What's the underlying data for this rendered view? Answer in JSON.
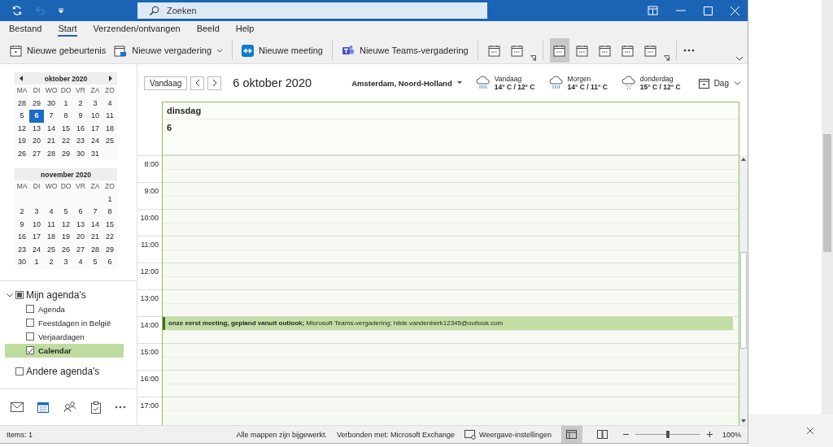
{
  "window": {
    "search_placeholder": "Zoeken"
  },
  "menu_tabs": [
    {
      "label": "Bestand",
      "selected": false
    },
    {
      "label": "Start",
      "selected": true
    },
    {
      "label": "Verzenden/ontvangen",
      "selected": false
    },
    {
      "label": "Beeld",
      "selected": false
    },
    {
      "label": "Help",
      "selected": false
    }
  ],
  "ribbon": [
    {
      "kind": "event",
      "label": "Nieuwe gebeurtenis"
    },
    {
      "kind": "meeting-request",
      "label": "Nieuwe vergadering",
      "dropdown": true
    },
    {
      "kind": "separator"
    },
    {
      "kind": "teams-app",
      "label": "Nieuwe meeting"
    },
    {
      "kind": "separator"
    },
    {
      "kind": "teams",
      "label": "Nieuwe Teams-vergadering"
    },
    {
      "kind": "separator"
    },
    {
      "kind": "view",
      "selected": false
    },
    {
      "kind": "view",
      "selected": false
    },
    {
      "kind": "launcher"
    },
    {
      "kind": "separator"
    },
    {
      "kind": "view",
      "selected": true
    },
    {
      "kind": "view",
      "selected": false
    },
    {
      "kind": "view",
      "selected": false
    },
    {
      "kind": "view",
      "selected": false
    },
    {
      "kind": "view",
      "selected": false
    },
    {
      "kind": "launcher"
    },
    {
      "kind": "separator"
    },
    {
      "kind": "more"
    }
  ],
  "mini_calendars": [
    {
      "title": "oktober 2020",
      "arrows": true,
      "weekdays": [
        "MA",
        "DI",
        "WO",
        "DO",
        "VR",
        "ZA",
        "ZO"
      ],
      "weeks": [
        {
          "days": [
            {
              "d": "28",
              "selected": false
            },
            {
              "d": "29",
              "selected": false
            },
            {
              "d": "30",
              "selected": false
            },
            {
              "d": "1",
              "selected": false
            },
            {
              "d": "2",
              "selected": false
            },
            {
              "d": "3",
              "selected": false
            },
            {
              "d": "4",
              "selected": false
            }
          ]
        },
        {
          "days": [
            {
              "d": "5",
              "selected": false
            },
            {
              "d": "6",
              "selected": true
            },
            {
              "d": "7",
              "selected": false
            },
            {
              "d": "8",
              "selected": false
            },
            {
              "d": "9",
              "selected": false
            },
            {
              "d": "10",
              "selected": false
            },
            {
              "d": "11",
              "selected": false
            }
          ]
        },
        {
          "days": [
            {
              "d": "12",
              "selected": false
            },
            {
              "d": "13",
              "selected": false
            },
            {
              "d": "14",
              "selected": false
            },
            {
              "d": "15",
              "selected": false
            },
            {
              "d": "16",
              "selected": false
            },
            {
              "d": "17",
              "selected": false
            },
            {
              "d": "18",
              "selected": false
            }
          ]
        },
        {
          "days": [
            {
              "d": "19",
              "selected": false
            },
            {
              "d": "20",
              "selected": false
            },
            {
              "d": "21",
              "selected": false
            },
            {
              "d": "22",
              "selected": false
            },
            {
              "d": "23",
              "selected": false
            },
            {
              "d": "24",
              "selected": false
            },
            {
              "d": "25",
              "selected": false
            }
          ]
        },
        {
          "days": [
            {
              "d": "26",
              "selected": false
            },
            {
              "d": "27",
              "selected": false
            },
            {
              "d": "28",
              "selected": false
            },
            {
              "d": "29",
              "selected": false
            },
            {
              "d": "30",
              "selected": false
            },
            {
              "d": "31",
              "selected": false
            }
          ]
        }
      ]
    },
    {
      "title": "november 2020",
      "arrows": false,
      "weekdays": [
        "MA",
        "DI",
        "WO",
        "DO",
        "VR",
        "ZA",
        "ZO"
      ],
      "weeks": [
        {
          "days": [
            {
              "d": "1",
              "selected": false
            }
          ]
        },
        {
          "days": [
            {
              "d": "2",
              "selected": false
            },
            {
              "d": "3",
              "selected": false
            },
            {
              "d": "4",
              "selected": false
            },
            {
              "d": "5",
              "selected": false
            },
            {
              "d": "6",
              "selected": false
            },
            {
              "d": "7",
              "selected": false
            },
            {
              "d": "8",
              "selected": false
            }
          ]
        },
        {
          "days": [
            {
              "d": "9",
              "selected": false
            },
            {
              "d": "10",
              "selected": false
            },
            {
              "d": "11",
              "selected": false
            },
            {
              "d": "12",
              "selected": false
            },
            {
              "d": "13",
              "selected": false
            },
            {
              "d": "14",
              "selected": false
            },
            {
              "d": "15",
              "selected": false
            }
          ]
        },
        {
          "days": [
            {
              "d": "16",
              "selected": false
            },
            {
              "d": "17",
              "selected": false
            },
            {
              "d": "18",
              "selected": false
            },
            {
              "d": "19",
              "selected": false
            },
            {
              "d": "20",
              "selected": false
            },
            {
              "d": "21",
              "selected": false
            },
            {
              "d": "22",
              "selected": false
            }
          ]
        },
        {
          "days": [
            {
              "d": "23",
              "selected": false
            },
            {
              "d": "24",
              "selected": false
            },
            {
              "d": "25",
              "selected": false
            },
            {
              "d": "26",
              "selected": false
            },
            {
              "d": "27",
              "selected": false
            },
            {
              "d": "28",
              "selected": false
            },
            {
              "d": "29",
              "selected": false
            }
          ]
        },
        {
          "days": [
            {
              "d": "30",
              "selected": false
            },
            {
              "d": "1",
              "selected": false
            },
            {
              "d": "2",
              "selected": false
            },
            {
              "d": "3",
              "selected": false
            },
            {
              "d": "4",
              "selected": false
            },
            {
              "d": "5",
              "selected": false
            },
            {
              "d": "6",
              "selected": false
            }
          ]
        }
      ]
    }
  ],
  "folders": [
    {
      "label": "Mijn agenda's",
      "expanded": true,
      "checked": true,
      "children": [
        {
          "label": "Agenda",
          "checked": false,
          "selected": false
        },
        {
          "label": "Feestdagen in België",
          "checked": false,
          "selected": false
        },
        {
          "label": "Verjaardagen",
          "checked": false,
          "selected": false
        },
        {
          "label": "Calendar",
          "checked": true,
          "selected": true
        }
      ]
    },
    {
      "label": "Andere agenda's",
      "checked": false
    }
  ],
  "nav": [
    {
      "kind": "mail",
      "selected": false
    },
    {
      "kind": "calendar",
      "selected": true
    },
    {
      "kind": "people",
      "selected": false
    },
    {
      "kind": "tasks",
      "selected": false
    },
    {
      "kind": "more",
      "selected": false
    }
  ],
  "calendar_toolbar": {
    "today_button": "Vandaag",
    "date": "6 oktober 2020",
    "location": "Amsterdam, Noord-Holland",
    "weather": [
      {
        "day": "Vandaag",
        "temps": "14° C / 12° C",
        "kind": "rain"
      },
      {
        "day": "Morgen",
        "temps": "14° C / 11° C",
        "kind": "rain"
      },
      {
        "day": "donderdag",
        "temps": "15° C / 12° C",
        "kind": "showers"
      }
    ],
    "view": "Dag"
  },
  "day_header": {
    "weekday": "dinsdag",
    "day": "6"
  },
  "hours": [
    {
      "label": "8:00"
    },
    {
      "label": "9:00"
    },
    {
      "label": "10:00"
    },
    {
      "label": "11:00"
    },
    {
      "label": "12:00"
    },
    {
      "label": "13:00"
    },
    {
      "label": "14:00",
      "event": "**onze eerst meeting, gepland vanuit outlook;** Microsoft Teams-vergadering; hilde.vandenberk12345@outlook.com"
    },
    {
      "label": "15:00"
    },
    {
      "label": "16:00"
    },
    {
      "label": "17:00"
    }
  ],
  "status_bar": {
    "items": "Items: 1",
    "sync": "Alle mappen zijn bijgewerkt.",
    "connection": "Verbonden met: Microsoft Exchange",
    "settings": "Weergave-instellingen",
    "views": [
      {
        "kind": "normal",
        "selected": true
      },
      {
        "kind": "reading",
        "selected": false
      }
    ],
    "zoom": {
      "level": 0.5,
      "reading": "100%"
    }
  }
}
